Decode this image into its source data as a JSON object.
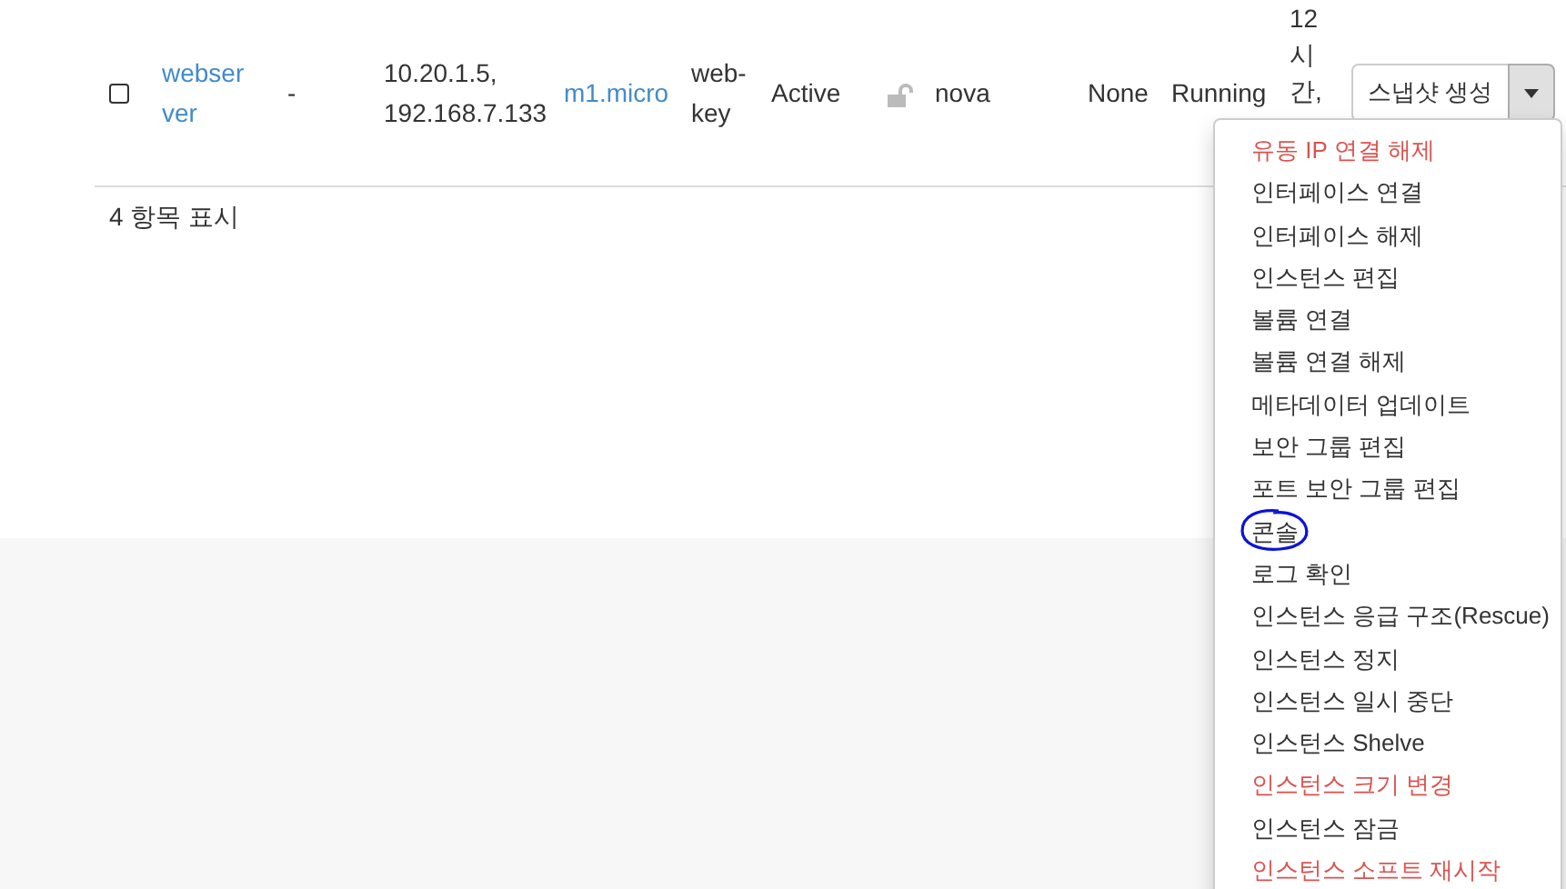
{
  "instance_row": {
    "selected": false,
    "name": "webserver",
    "image": "-",
    "ip_address": "10.20.1.5, 192.168.7.133",
    "flavor": "m1.micro",
    "key_pair": "web-key",
    "status": "Active",
    "locked": false,
    "availability_zone": "nova",
    "task": "None",
    "power_state": "Running",
    "age": "12시간,",
    "primary_action": "스냅샷 생성"
  },
  "footer": {
    "count_text": "4 항목 표시"
  },
  "actions_menu": {
    "expanded": true,
    "items": [
      {
        "label": "유동 IP 연결 해제",
        "danger": true,
        "highlighted": false
      },
      {
        "label": "인터페이스 연결",
        "danger": false,
        "highlighted": false
      },
      {
        "label": "인터페이스 해제",
        "danger": false,
        "highlighted": false
      },
      {
        "label": "인스턴스 편집",
        "danger": false,
        "highlighted": false
      },
      {
        "label": "볼륨 연결",
        "danger": false,
        "highlighted": false
      },
      {
        "label": "볼륨 연결 해제",
        "danger": false,
        "highlighted": false
      },
      {
        "label": "메타데이터 업데이트",
        "danger": false,
        "highlighted": false
      },
      {
        "label": "보안 그룹 편집",
        "danger": false,
        "highlighted": false
      },
      {
        "label": "포트 보안 그룹 편집",
        "danger": false,
        "highlighted": false
      },
      {
        "label": "콘솔",
        "danger": false,
        "highlighted": true
      },
      {
        "label": "로그 확인",
        "danger": false,
        "highlighted": false
      },
      {
        "label": "인스턴스 응급 구조(Rescue)",
        "danger": false,
        "highlighted": false
      },
      {
        "label": "인스턴스 정지",
        "danger": false,
        "highlighted": false
      },
      {
        "label": "인스턴스 일시 중단",
        "danger": false,
        "highlighted": false
      },
      {
        "label": "인스턴스 Shelve",
        "danger": false,
        "highlighted": false
      },
      {
        "label": "인스턴스 크기 변경",
        "danger": true,
        "highlighted": false
      },
      {
        "label": "인스턴스 잠금",
        "danger": false,
        "highlighted": false
      },
      {
        "label": "인스턴스 소프트 재시작",
        "danger": true,
        "highlighted": false
      }
    ]
  }
}
